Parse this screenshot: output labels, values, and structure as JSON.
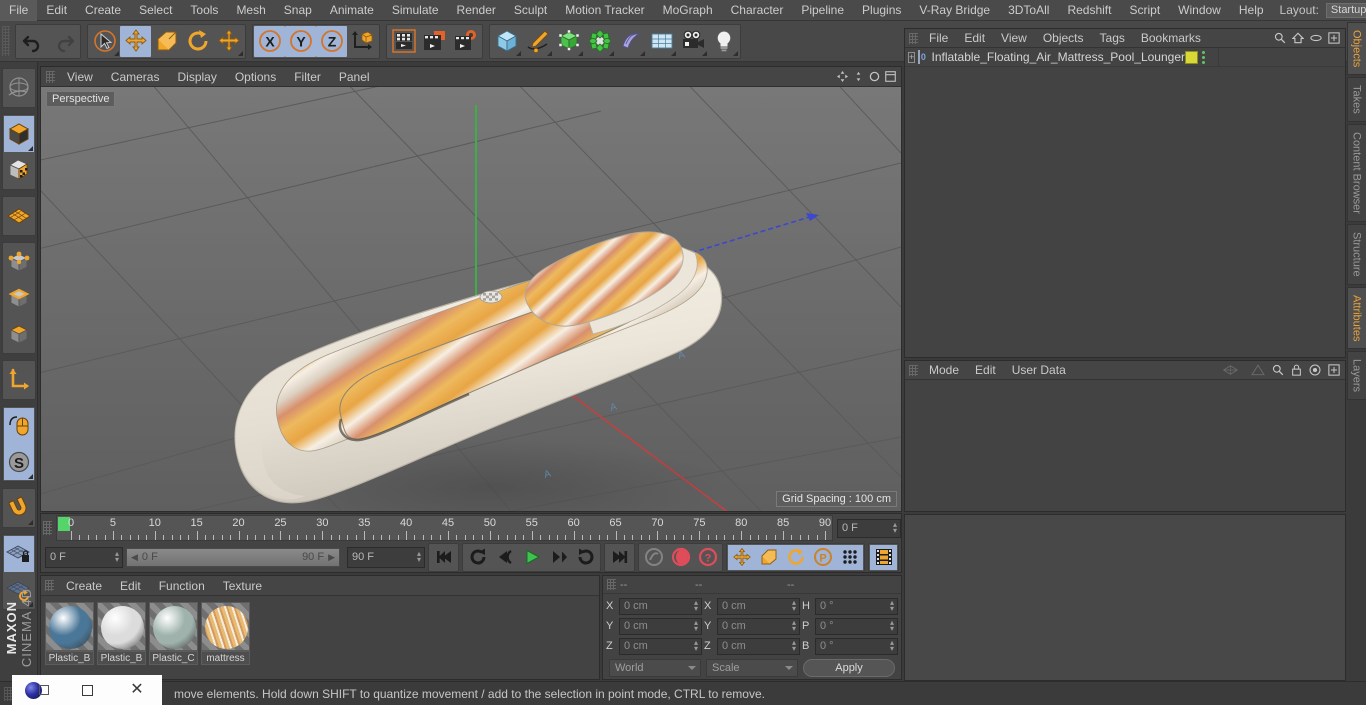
{
  "menubar": {
    "items": [
      "File",
      "Edit",
      "Create",
      "Select",
      "Tools",
      "Mesh",
      "Snap",
      "Animate",
      "Simulate",
      "Render",
      "Sculpt",
      "Motion Tracker",
      "MoGraph",
      "Character",
      "Pipeline",
      "Plugins",
      "V-Ray Bridge",
      "3DToAll",
      "Redshift",
      "Script",
      "Window",
      "Help"
    ],
    "layout_label": "Layout:",
    "layout_value": "Startup"
  },
  "toolbar": {
    "undo": "undo-arrow",
    "redo": "redo-arrow",
    "select": "selection-cursor",
    "move": "move-tool",
    "scale": "scale-tool",
    "rotate": "rotate-tool",
    "move2": "move-axis",
    "axis_x": "X",
    "axis_y": "Y",
    "axis_z": "Z",
    "world_axis": "world-coordinate",
    "render_view": "render-view",
    "render_region": "render-region",
    "render_settings": "render-settings",
    "cube": "primitive-cube",
    "spline": "spline-pen",
    "generator": "generator-object",
    "deformer": "deformer-object",
    "scene_obj": "scene-object",
    "environment": "environment-floor",
    "camera": "camera-object",
    "light": "light-object"
  },
  "left_toolbar": {
    "items": [
      {
        "name": "make-editable-icon",
        "active": false
      },
      {
        "name": "model-mode-icon",
        "active": true
      },
      {
        "name": "texture-mode-icon",
        "active": false
      },
      {
        "name": "polygon-grid-icon",
        "active": false
      },
      {
        "name": "point-mode-icon",
        "active": false
      },
      {
        "name": "edge-mode-icon",
        "active": false
      },
      {
        "name": "polygon-mode-icon",
        "active": false
      },
      {
        "name": "axis-modify-icon",
        "active": false
      },
      {
        "name": "viewport-solo-icon",
        "active": true
      },
      {
        "name": "snap-enable-icon",
        "active": true
      },
      {
        "name": "magnet-icon",
        "active": false
      },
      {
        "name": "workplane-lock-icon",
        "active": true
      },
      {
        "name": "workplane-rotate-icon",
        "active": false
      }
    ]
  },
  "viewport": {
    "menu": [
      "View",
      "Cameras",
      "Display",
      "Options",
      "Filter",
      "Panel"
    ],
    "perspective_label": "Perspective",
    "grid_spacing": "Grid Spacing : 100 cm",
    "axis_x": "X",
    "axis_y": "Y",
    "axis_z": "Z",
    "colors": {
      "background_top": "#747474",
      "background_bottom": "#636363",
      "grid_line": "#5a5a5a",
      "stripe_orange": "#e8a547",
      "stripe_cream": "#f2e6d2",
      "stripe_rose": "#d98a6a",
      "body_white": "#f0ece4",
      "axis_x_color": "#cc4444",
      "axis_y_color": "#44bb44",
      "axis_z_color": "#4455dd"
    }
  },
  "timeline": {
    "tick_labels": [
      "0",
      "5",
      "10",
      "15",
      "20",
      "25",
      "30",
      "35",
      "40",
      "45",
      "50",
      "55",
      "60",
      "65",
      "70",
      "75",
      "80",
      "85",
      "90"
    ],
    "current_frame": "0 F",
    "range_start": "0 F",
    "range_end": "90 F",
    "end_frame": "90 F",
    "right_frame": "0 F",
    "buttons": [
      {
        "name": "go-to-start-button",
        "icon": "|<<"
      },
      {
        "name": "previous-key-button",
        "icon": "prev-key"
      },
      {
        "name": "step-back-button",
        "icon": "<|"
      },
      {
        "name": "play-button",
        "icon": "play"
      },
      {
        "name": "step-forward-button",
        "icon": "|>"
      },
      {
        "name": "next-key-button",
        "icon": "next-key"
      },
      {
        "name": "go-to-end-button",
        "icon": ">>|"
      },
      {
        "name": "record-keyframe-button",
        "icon": "record"
      },
      {
        "name": "autokey-button",
        "icon": "autokey"
      },
      {
        "name": "keyframe-selection-button",
        "icon": "question"
      },
      {
        "name": "position-key-button",
        "icon": "move"
      },
      {
        "name": "scale-key-button",
        "icon": "scale"
      },
      {
        "name": "rotation-key-button",
        "icon": "rotate"
      },
      {
        "name": "parameter-key-button",
        "icon": "P"
      },
      {
        "name": "pla-key-button",
        "icon": "dots"
      },
      {
        "name": "timeline-button",
        "icon": "film"
      }
    ]
  },
  "materials": {
    "menu": [
      "Create",
      "Edit",
      "Function",
      "Texture"
    ],
    "items": [
      {
        "label": "Plastic_B",
        "color": "#4a7697"
      },
      {
        "label": "Plastic_B",
        "color": "#dcdcdc"
      },
      {
        "label": "Plastic_C",
        "color": "#9fb3ac"
      },
      {
        "label": "mattress",
        "color": "#d7ab6b"
      }
    ]
  },
  "coordinates": {
    "header": [
      "--",
      "--",
      "--"
    ],
    "rows": [
      {
        "label1": "X",
        "value1": "0 cm",
        "label2": "X",
        "value2": "0 cm",
        "label3": "H",
        "value3": "0 °"
      },
      {
        "label1": "Y",
        "value1": "0 cm",
        "label2": "Y",
        "value2": "0 cm",
        "label3": "P",
        "value3": "0 °"
      },
      {
        "label1": "Z",
        "value1": "0 cm",
        "label2": "Z",
        "value2": "0 cm",
        "label3": "B",
        "value3": "0 °"
      }
    ],
    "system": "World",
    "mode": "Scale",
    "apply": "Apply"
  },
  "object_manager": {
    "menu": [
      "File",
      "Edit",
      "View",
      "Objects",
      "Tags",
      "Bookmarks"
    ],
    "object_name": "Inflatable_Floating_Air_Mattress_Pool_Lounger",
    "object_level": "0",
    "tag_color": "#d8d836"
  },
  "attributes": {
    "menu": [
      "Mode",
      "Edit",
      "User Data"
    ]
  },
  "right_tabs": [
    {
      "label": "Objects",
      "active": true
    },
    {
      "label": "Takes",
      "active": false
    },
    {
      "label": "Content Browser",
      "active": false
    },
    {
      "label": "Structure",
      "active": false
    },
    {
      "label": "Attributes",
      "active": true
    },
    {
      "label": "Layers",
      "active": false
    }
  ],
  "brand": {
    "line1": "MAXON",
    "line2": "CINEMA 4D"
  },
  "statusbar": {
    "text": "move elements. Hold down SHIFT to quantize movement / add to the selection in point mode, CTRL to remove."
  }
}
